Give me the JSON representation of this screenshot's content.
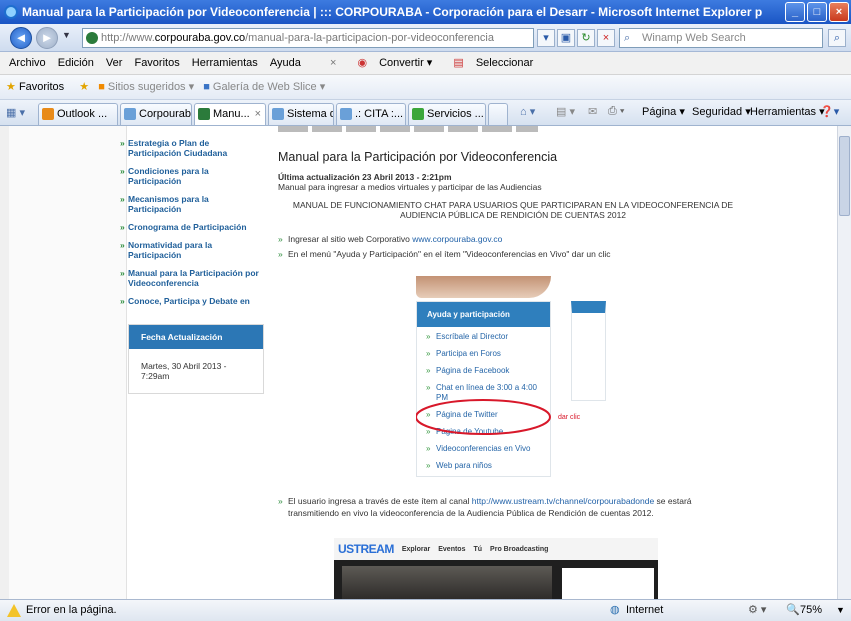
{
  "window": {
    "title": "Manual para la Participación por Videoconferencia | ::: CORPOURABA - Corporación para el Desarr - Microsoft Internet Explorer p"
  },
  "address": {
    "url_prefix": "http://www.",
    "url_domain": "corpouraba.gov.co",
    "url_path": "/manual-para-la-participacion-por-videoconferencia",
    "search_placeholder": "Winamp Web Search"
  },
  "menu": [
    "Archivo",
    "Edición",
    "Ver",
    "Favoritos",
    "Herramientas",
    "Ayuda"
  ],
  "toolbar": {
    "convertir": "Convertir",
    "seleccionar": "Seleccionar"
  },
  "favbar": {
    "favoritos": "Favoritos",
    "sitios": "Sitios sugeridos",
    "galeria": "Galería de Web Slice"
  },
  "tabs": [
    "Outlook ...",
    "Corpouraba",
    "Manu...",
    "Sistema d...",
    ".: CITA :...",
    "Servicios ..."
  ],
  "commandbar": {
    "pagina": "Página",
    "seguridad": "Seguridad",
    "herramientas": "Herramientas"
  },
  "sidebar": {
    "items": [
      "Estrategia o Plan de Participación Ciudadana",
      "Condiciones para la Participación",
      "Mecanismos para la Participación",
      "Cronograma de Participación",
      "Normatividad para la Participación",
      "Manual para la Participación por Videoconferencia",
      "Conoce, Participa y Debate en"
    ],
    "fecha_title": "Fecha Actualización",
    "fecha_value": "Martes, 30 Abril 2013 - 7:29am"
  },
  "main": {
    "title": "Manual para la Participación por Videoconferencia",
    "updated": "Última actualización 23 Abril 2013 - 2:21pm",
    "subtitle": "Manual para ingresar a medios virtuales y participar de las Audiencias",
    "heading1": "MANUAL DE FUNCIONAMIENTO CHAT PARA USUARIOS QUE PARTICIPARAN EN LA VIDEOCONFERENCIA DE",
    "heading2": "AUDIENCIA PÚBLICA DE RENDICIÓN DE CUENTAS 2012",
    "step1": "Ingresar al sitio web Corporativo ",
    "step1_link": "www.corpouraba.gov.co",
    "step2": "En el menú \"Ayuda y Participación\" en el ítem \"Videoconferencias en Vivo\"   dar un clic",
    "step3a": "El usuario ingresa a través de este ítem al canal ",
    "step3_link": "http://www.ustream.tv/channel/corpourabadonde",
    "step3b": " se estará",
    "step3c": "transmitiendo en vivo la videoconferencia de la Audiencia Pública de Rendición de cuentas 2012."
  },
  "ayuda_menu": {
    "title": "Ayuda y participación",
    "items": [
      "Escríbale al Director",
      "Participa en Foros",
      "Página de Facebook",
      "Chat en línea de 3:00 a 4:00 PM",
      "Página de Twitter",
      "Página de Youtube",
      "Videoconferencias en Vivo",
      "Web para niños"
    ],
    "annotation": "dar clic"
  },
  "ustream": {
    "logo": "USTREAM",
    "nav": [
      "Explorar",
      "Eventos",
      "Tú",
      "Pro Broadcasting"
    ]
  },
  "statusbar": {
    "error": "Error en la página.",
    "zone": "Internet",
    "zoom": "75%"
  }
}
